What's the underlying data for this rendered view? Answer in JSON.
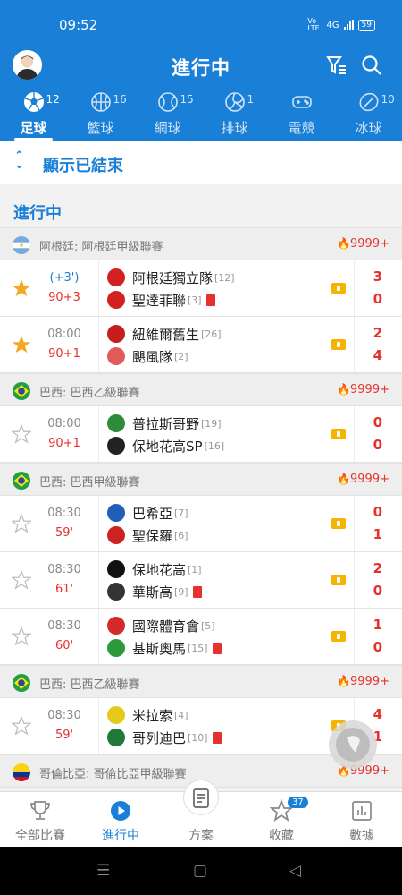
{
  "status": {
    "time": "09:52",
    "network": "4G",
    "volte": "Vo LTE",
    "battery": "59"
  },
  "header": {
    "title": "進行中"
  },
  "sport_tabs": [
    {
      "label": "足球",
      "count": "12",
      "icon": "soccer-icon",
      "active": true
    },
    {
      "label": "籃球",
      "count": "16",
      "icon": "basketball-icon",
      "active": false
    },
    {
      "label": "網球",
      "count": "15",
      "icon": "tennis-icon",
      "active": false
    },
    {
      "label": "排球",
      "count": "1",
      "icon": "volleyball-icon",
      "active": false
    },
    {
      "label": "電競",
      "count": "",
      "icon": "gamepad-icon",
      "active": false
    },
    {
      "label": "冰球",
      "count": "10",
      "icon": "hockey-icon",
      "active": false
    }
  ],
  "finished_toggle": {
    "label": "顯示已結束"
  },
  "section_title": "進行中",
  "groups": [
    {
      "league": "阿根廷: 阿根廷甲級聯賽",
      "flag": "argentina",
      "heat": "9999+",
      "matches": [
        {
          "starred": true,
          "t1": "(+3')",
          "t1_blue": true,
          "t2": "90+3",
          "home": {
            "name": "阿根廷獨立隊",
            "rank": "[12]",
            "red": false,
            "crest": "#d32020"
          },
          "away": {
            "name": "聖達菲聯",
            "rank": "[3]",
            "red": true,
            "crest": "#d32020"
          },
          "score_home": "3",
          "score_away": "0"
        },
        {
          "starred": true,
          "t1": "08:00",
          "t1_blue": false,
          "t2": "90+1",
          "home": {
            "name": "紐維爾舊生",
            "rank": "[26]",
            "red": false,
            "crest": "#c81d1d"
          },
          "away": {
            "name": "颶風隊",
            "rank": "[2]",
            "red": false,
            "crest": "#e25a5a"
          },
          "score_home": "2",
          "score_away": "4"
        }
      ]
    },
    {
      "league": "巴西: 巴西乙級聯賽",
      "flag": "brazil",
      "heat": "9999+",
      "matches": [
        {
          "starred": false,
          "t1": "08:00",
          "t1_blue": false,
          "t2": "90+1",
          "home": {
            "name": "普拉斯哥野",
            "rank": "[19]",
            "red": false,
            "crest": "#2e8b3a"
          },
          "away": {
            "name": "保地花高SP",
            "rank": "[16]",
            "red": false,
            "crest": "#222222"
          },
          "score_home": "0",
          "score_away": "0"
        }
      ]
    },
    {
      "league": "巴西: 巴西甲級聯賽",
      "flag": "brazil",
      "heat": "9999+",
      "matches": [
        {
          "starred": false,
          "t1": "08:30",
          "t1_blue": false,
          "t2": "59'",
          "home": {
            "name": "巴希亞",
            "rank": "[7]",
            "red": false,
            "crest": "#1f5fb8"
          },
          "away": {
            "name": "聖保羅",
            "rank": "[6]",
            "red": false,
            "crest": "#cc2222"
          },
          "score_home": "0",
          "score_away": "1"
        },
        {
          "starred": false,
          "t1": "08:30",
          "t1_blue": false,
          "t2": "61'",
          "home": {
            "name": "保地花高",
            "rank": "[1]",
            "red": false,
            "crest": "#111111"
          },
          "away": {
            "name": "華斯高",
            "rank": "[9]",
            "red": true,
            "crest": "#333333"
          },
          "score_home": "2",
          "score_away": "0"
        },
        {
          "starred": false,
          "t1": "08:30",
          "t1_blue": false,
          "t2": "60'",
          "home": {
            "name": "國際體育會",
            "rank": "[5]",
            "red": false,
            "crest": "#d42a2a"
          },
          "away": {
            "name": "基斯奧馬",
            "rank": "[15]",
            "red": true,
            "crest": "#2c9a3a"
          },
          "score_home": "1",
          "score_away": "0"
        }
      ]
    },
    {
      "league": "巴西: 巴西乙級聯賽",
      "flag": "brazil",
      "heat": "9999+",
      "matches": [
        {
          "starred": false,
          "t1": "08:30",
          "t1_blue": false,
          "t2": "59'",
          "home": {
            "name": "米拉索",
            "rank": "[4]",
            "red": false,
            "crest": "#e6c81a"
          },
          "away": {
            "name": "哥列迪巴",
            "rank": "[10]",
            "red": true,
            "crest": "#1f7a3a"
          },
          "score_home": "4",
          "score_away": "1"
        }
      ]
    },
    {
      "league": "哥倫比亞: 哥倫比亞甲級聯賽",
      "flag": "colombia",
      "heat": "9999+",
      "matches": []
    }
  ],
  "bottom_nav": [
    {
      "label": "全部比賽",
      "icon": "trophy-icon",
      "active": false,
      "badge": ""
    },
    {
      "label": "進行中",
      "icon": "play-icon",
      "active": true,
      "badge": ""
    },
    {
      "label": "方案",
      "icon": "document-icon",
      "active": false,
      "badge": ""
    },
    {
      "label": "收藏",
      "icon": "star-icon",
      "active": false,
      "badge": "37"
    },
    {
      "label": "數據",
      "icon": "chart-icon",
      "active": false,
      "badge": ""
    }
  ]
}
